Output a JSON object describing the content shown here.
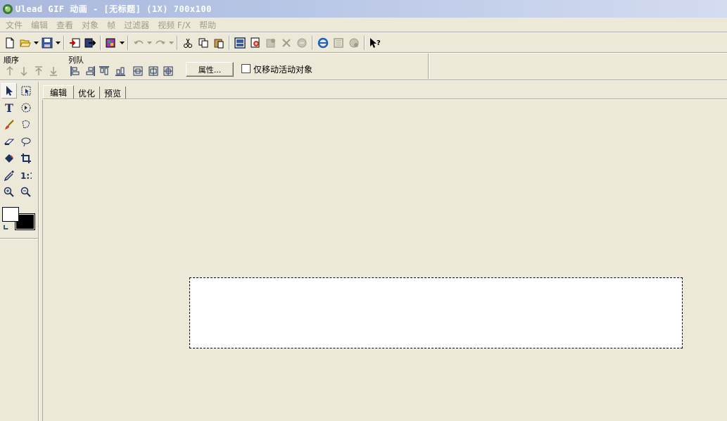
{
  "window": {
    "title": "Ulead GIF 动画 - [无标题] (1X) 700x100"
  },
  "menu": {
    "items": [
      "文件",
      "编辑",
      "查看",
      "对象",
      "帧",
      "过滤器",
      "视频 F/X",
      "帮助"
    ]
  },
  "toolbar": {
    "icons": [
      "new-file-icon",
      "open-folder-icon",
      "save-icon",
      "import-icon",
      "export-icon",
      "palette-icon",
      "undo-icon",
      "redo-icon",
      "cut-icon",
      "copy-icon",
      "paste-icon",
      "add-frame-icon",
      "add-image-icon",
      "frame-props-icon",
      "crop-icon",
      "tween-icon",
      "preview-browser-icon",
      "optimize-icon",
      "optimize-wizard-icon",
      "context-help-icon"
    ]
  },
  "order_bar": {
    "order_label": "顺序",
    "align_label": "列队",
    "properties_button": "属性...",
    "move_active_only_label": "仅移动活动对象",
    "move_active_only_checked": false
  },
  "tabs": [
    {
      "label": "编辑",
      "active": true
    },
    {
      "label": "优化",
      "active": false
    },
    {
      "label": "预览",
      "active": false
    }
  ],
  "colors": {
    "foreground": "#ffffff",
    "background": "#000000",
    "face": "#ece9d8",
    "disabled_text": "#a09d8c"
  }
}
